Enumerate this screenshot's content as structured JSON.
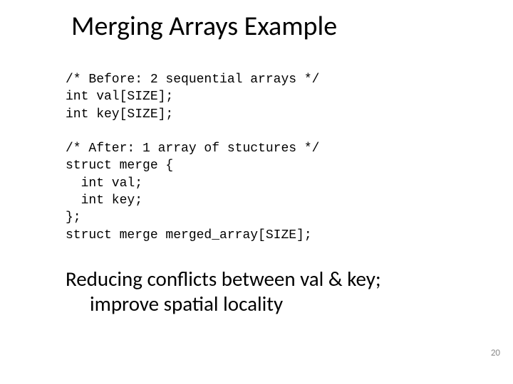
{
  "title": "Merging Arrays Example",
  "code": {
    "l1": "/* Before: 2 sequential arrays */",
    "l2": "int val[SIZE];",
    "l3": "int key[SIZE];",
    "l4": "",
    "l5": "/* After: 1 array of stuctures */",
    "l6": "struct merge {",
    "l7": "  int val;",
    "l8": "  int key;",
    "l9": "};",
    "l10": "struct merge merged_array[SIZE];"
  },
  "summary": {
    "line1": "Reducing conflicts between val & key;",
    "line2": "improve spatial locality"
  },
  "page_number": "20"
}
